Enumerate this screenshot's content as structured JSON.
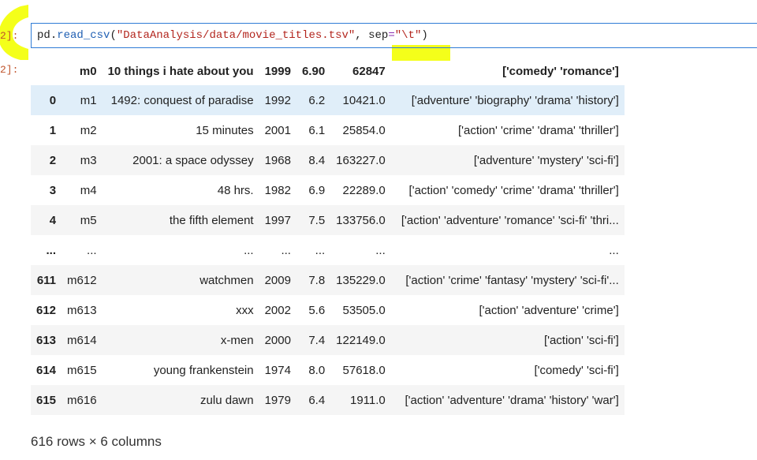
{
  "prompts": {
    "input": "2]:",
    "output": "2]:"
  },
  "code": {
    "obj": "pd",
    "dot": ".",
    "fn": "read_csv",
    "open": "(",
    "path": "\"DataAnalysis/data/movie_titles.tsv\"",
    "comma": ", ",
    "kw": "sep",
    "eq": "=",
    "sep_val": "\"\\t\"",
    "close": ")"
  },
  "table": {
    "columns": [
      "",
      "m0",
      "10 things i hate about you",
      "1999",
      "6.90",
      "62847",
      "['comedy' 'romance']"
    ],
    "rows": [
      [
        "0",
        "m1",
        "1492: conquest of paradise",
        "1992",
        "6.2",
        "10421.0",
        "['adventure' 'biography' 'drama' 'history']"
      ],
      [
        "1",
        "m2",
        "15 minutes",
        "2001",
        "6.1",
        "25854.0",
        "['action' 'crime' 'drama' 'thriller']"
      ],
      [
        "2",
        "m3",
        "2001: a space odyssey",
        "1968",
        "8.4",
        "163227.0",
        "['adventure' 'mystery' 'sci-fi']"
      ],
      [
        "3",
        "m4",
        "48 hrs.",
        "1982",
        "6.9",
        "22289.0",
        "['action' 'comedy' 'crime' 'drama' 'thriller']"
      ],
      [
        "4",
        "m5",
        "the fifth element",
        "1997",
        "7.5",
        "133756.0",
        "['action' 'adventure' 'romance' 'sci-fi' 'thri..."
      ],
      [
        "...",
        "...",
        "...",
        "...",
        "...",
        "...",
        "..."
      ],
      [
        "611",
        "m612",
        "watchmen",
        "2009",
        "7.8",
        "135229.0",
        "['action' 'crime' 'fantasy' 'mystery' 'sci-fi'..."
      ],
      [
        "612",
        "m613",
        "xxx",
        "2002",
        "5.6",
        "53505.0",
        "['action' 'adventure' 'crime']"
      ],
      [
        "613",
        "m614",
        "x-men",
        "2000",
        "7.4",
        "122149.0",
        "['action' 'sci-fi']"
      ],
      [
        "614",
        "m615",
        "young frankenstein",
        "1974",
        "8.0",
        "57618.0",
        "['comedy' 'sci-fi']"
      ],
      [
        "615",
        "m616",
        "zulu dawn",
        "1979",
        "6.4",
        "1911.0",
        "['action' 'adventure' 'drama' 'history' 'war']"
      ]
    ],
    "selected_row": 0
  },
  "shape_info": "616 rows × 6 columns",
  "colors": {
    "highlighter": "#f4ff1a",
    "cell_border": "#2f7cd6",
    "selected_row": "#e0eef9",
    "striped_row": "#f5f5f5",
    "prompt": "#c0542b"
  }
}
